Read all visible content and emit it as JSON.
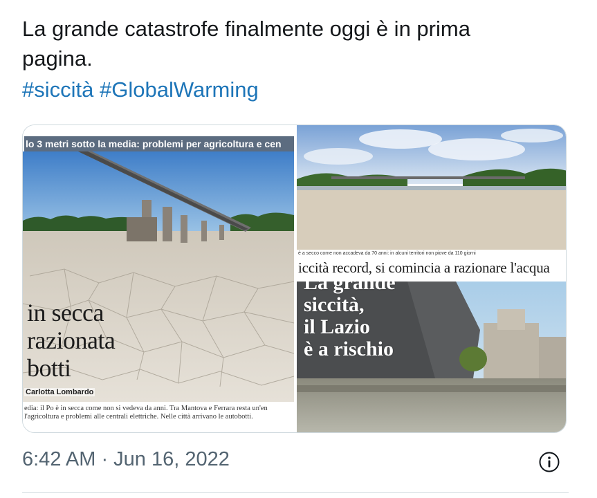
{
  "tweet": {
    "text_line1": "La grande catastrofe finalmente oggi è in prima",
    "text_line2": "pagina.",
    "hashtags": [
      "#siccità",
      "#GlobalWarming"
    ],
    "timestamp": "6:42 AM · Jun 16, 2022"
  },
  "media": {
    "left": {
      "top_headline": "lo 3 metri sotto la media: problemi per agricoltura e cen",
      "title_lines": [
        "in secca",
        "razionata",
        "botti"
      ],
      "author": "Carlotta Lombardo",
      "caption_line1": "edia: il Po è in secca come non si vedeva da anni. Tra Mantova e Ferrara resta un'en",
      "caption_line2": "l'agricoltura e problemi alle centrali elettriche. Nelle città arrivano le autobotti."
    },
    "top_right": {
      "caption": "è a secco come non accadeva da 70 anni: in alcuni territori non piove da 110 giorni",
      "headline": "iccità record, si comincia a razionare l'acqua"
    },
    "bottom_right": {
      "title_lines": [
        "La grande",
        "siccità,",
        "il Lazio",
        "è a rischio"
      ]
    }
  },
  "colors": {
    "hashtag": "#1d75b8",
    "meta": "#536471",
    "border": "#cfd9de"
  },
  "icons": {
    "info": "info-circle-icon"
  }
}
